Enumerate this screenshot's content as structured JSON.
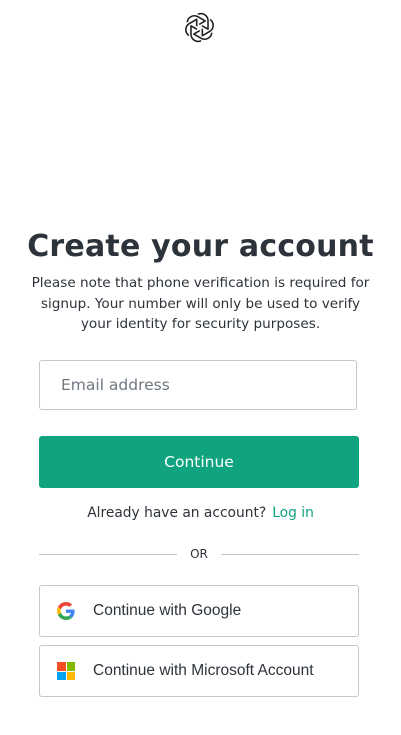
{
  "logo": {
    "icon": "openai-logo-icon"
  },
  "heading": {
    "title": "Create your account",
    "subtitle": "Please note that phone verification is required for signup. Your number will only be used to verify your identity for security purposes."
  },
  "form": {
    "email_placeholder": "Email address",
    "email_value": "",
    "continue_label": "Continue"
  },
  "login": {
    "prompt": "Already have an account?",
    "link_label": "Log in"
  },
  "divider": {
    "label": "OR"
  },
  "social": {
    "google": {
      "label": "Continue with Google",
      "icon": "google-icon"
    },
    "microsoft": {
      "label": "Continue with Microsoft Account",
      "icon": "microsoft-icon"
    }
  },
  "colors": {
    "accent": "#10a37f",
    "text": "#2d333a",
    "border": "#c2c8d0",
    "microsoft_red": "#f25022",
    "microsoft_green": "#7fba00",
    "microsoft_blue": "#00a4ef",
    "microsoft_yellow": "#ffb900"
  }
}
